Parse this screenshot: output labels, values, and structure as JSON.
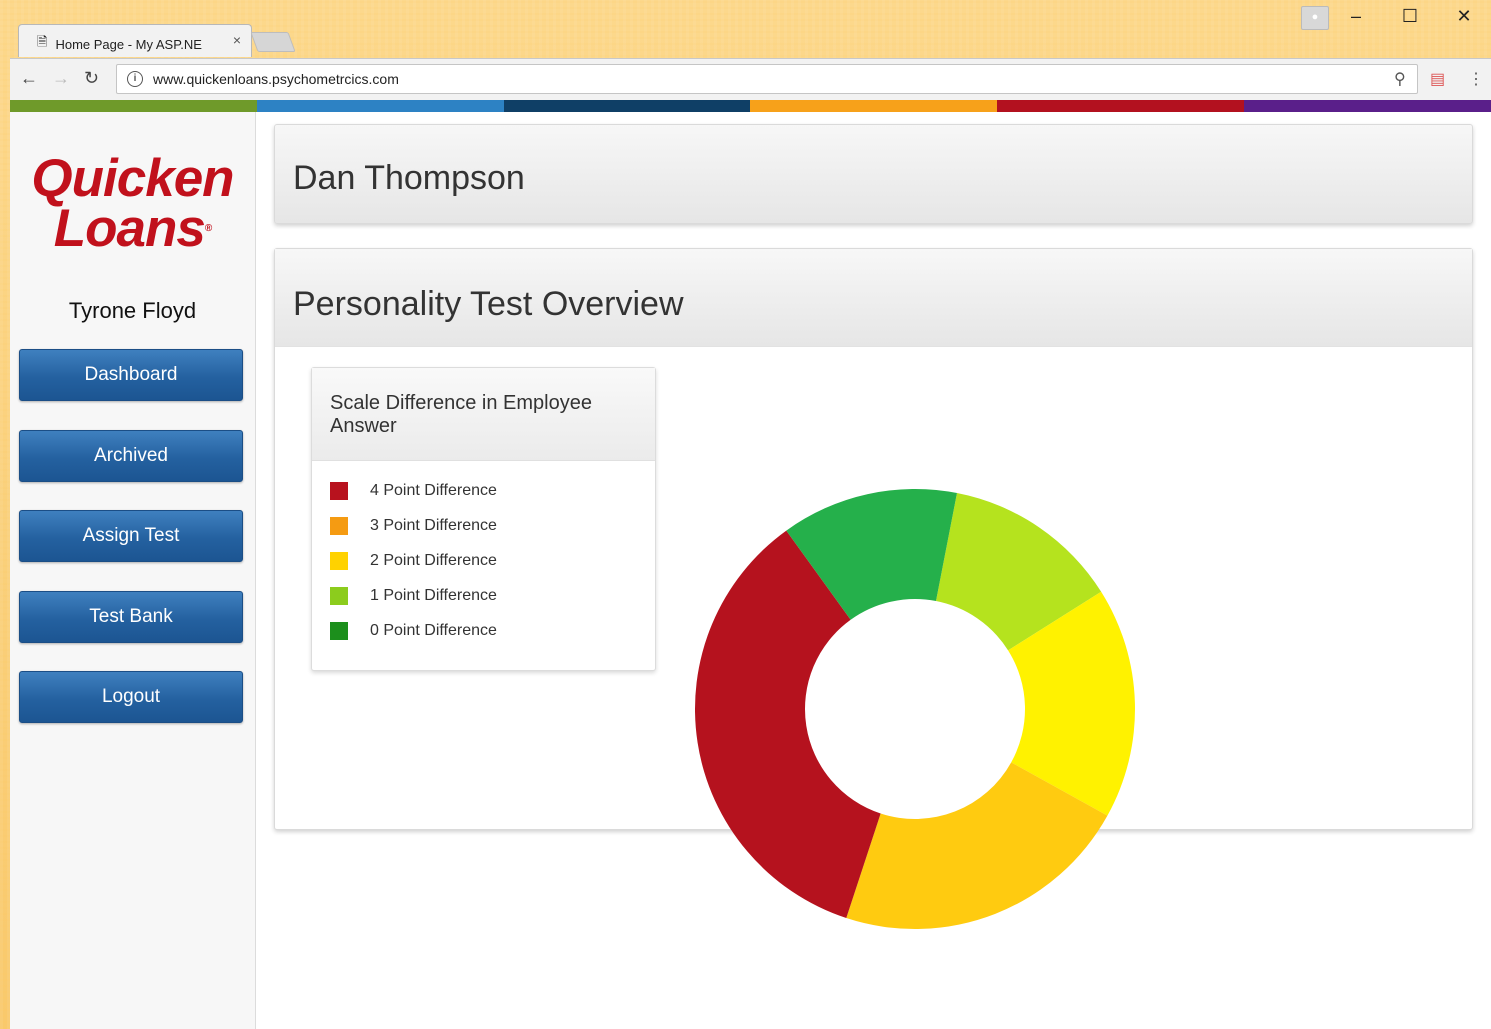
{
  "browser": {
    "tab_title": "Home Page - My ASP.NE",
    "tab_close": "×",
    "url": "www.quickenloans.psychometrcics.com",
    "window_controls": {
      "minimize": "–",
      "maximize": "☐",
      "close": "✕"
    }
  },
  "stripe_colors": [
    "#6f9a2a",
    "#2d82c4",
    "#0f3f66",
    "#f7a11a",
    "#b3111f",
    "#5a1f8a"
  ],
  "sidebar": {
    "logo_line1": "Quicken",
    "logo_line2": "Loans",
    "logo_mark": "®",
    "user": "Tyrone Floyd",
    "nav": [
      "Dashboard",
      "Archived",
      "Assign Test",
      "Test Bank",
      "Logout"
    ]
  },
  "header": {
    "name": "Dan Thompson"
  },
  "overview": {
    "title": "Personality Test Overview",
    "legend_title": "Scale Difference in Employee Answer"
  },
  "colors": {
    "brand_red": "#c1111c",
    "nav_blue": "#2461a0"
  },
  "chart_data": {
    "type": "pie",
    "variant": "donut",
    "legend": [
      {
        "label": "4 Point Difference",
        "color": "#b8121e"
      },
      {
        "label": "3 Point Difference",
        "color": "#f59b12"
      },
      {
        "label": "2 Point Difference",
        "color": "#ffd200"
      },
      {
        "label": "1 Point Difference",
        "color": "#8ccc1d"
      },
      {
        "label": "0 Point Difference",
        "color": "#1c8f1c"
      }
    ],
    "slices": [
      {
        "value": 13,
        "color": "#b5e31e"
      },
      {
        "value": 17,
        "color": "#fff200"
      },
      {
        "value": 22,
        "color": "#ffcb10"
      },
      {
        "value": 35,
        "color": "#b5121e"
      },
      {
        "value": 13,
        "color": "#25b04b"
      }
    ],
    "start_angle_deg": 11
  }
}
